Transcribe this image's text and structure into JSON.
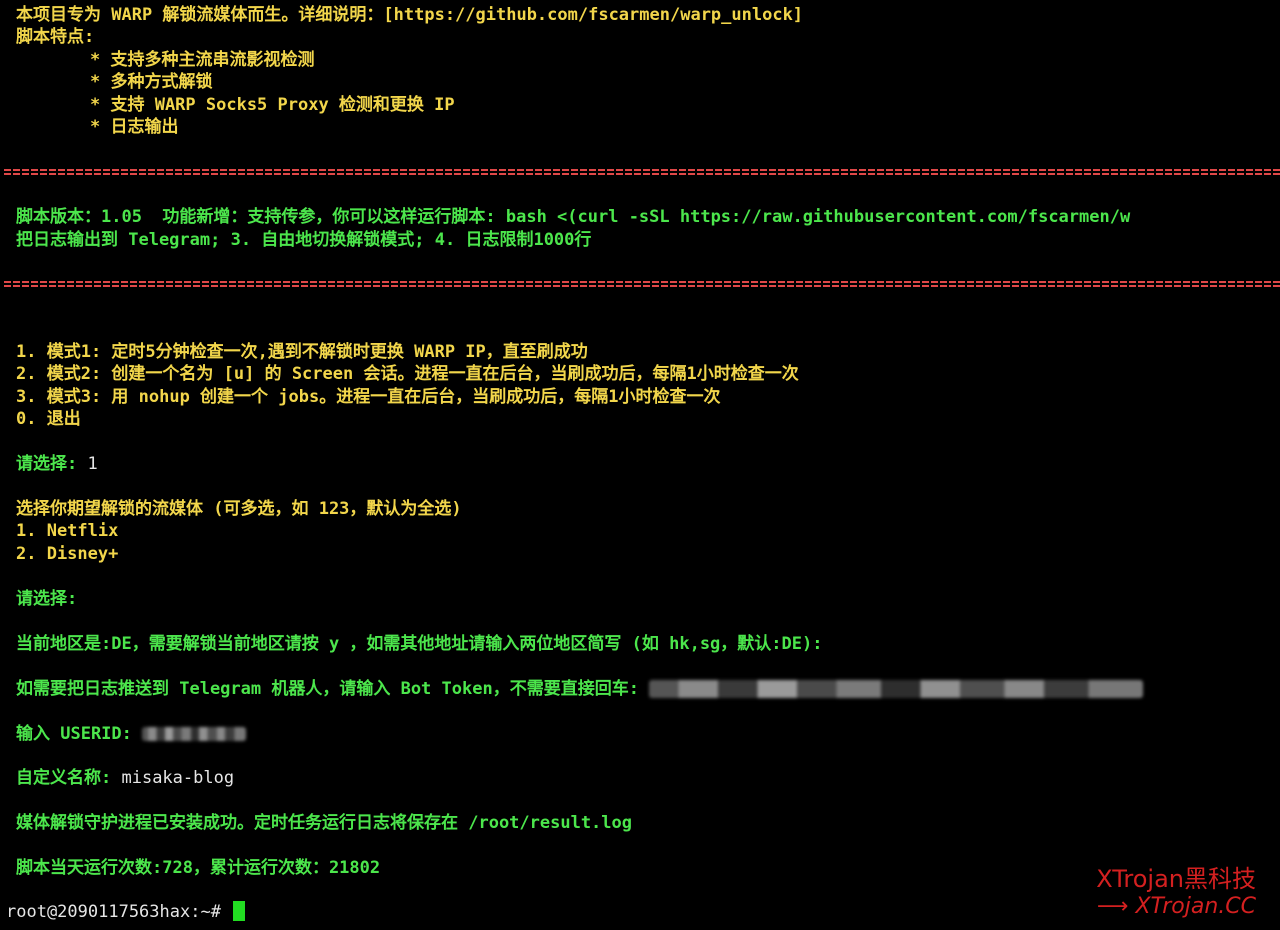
{
  "intro": {
    "line1": "本项目专为 WARP 解锁流媒体而生。详细说明：[https://github.com/fscarmen/warp_unlock]",
    "features_title": "脚本特点:",
    "features": [
      "* 支持多种主流串流影视检测",
      "* 多种方式解锁",
      "* 支持 WARP Socks5 Proxy 检测和更换 IP",
      "* 日志输出"
    ]
  },
  "version": {
    "line1": "脚本版本：1.05  功能新增：支持传参，你可以这样运行脚本: bash <(curl -sSL https://raw.githubusercontent.com/fscarmen/w",
    "line2": "把日志输出到 Telegram; 3. 自由地切换解锁模式; 4. 日志限制1000行"
  },
  "modes": [
    "1. 模式1: 定时5分钟检查一次,遇到不解锁时更换 WARP IP，直至刷成功",
    "2. 模式2: 创建一个名为 [u] 的 Screen 会话。进程一直在后台，当刷成功后，每隔1小时检查一次",
    "3. 模式3: 用 nohup 创建一个 jobs。进程一直在后台，当刷成功后，每隔1小时检查一次",
    "0. 退出"
  ],
  "choice1": {
    "label": "请选择: ",
    "value": "1"
  },
  "media": {
    "title": "选择你期望解锁的流媒体 (可多选，如 123，默认为全选)",
    "options": [
      "1. Netflix",
      "2. Disney+"
    ]
  },
  "choice2": {
    "label": "请选择: "
  },
  "region": "当前地区是:DE，需要解锁当前地区请按 y ，如需其他地址请输入两位地区简写 (如 hk,sg，默认:DE):",
  "telegram": "如需要把日志推送到 Telegram 机器人，请输入 Bot Token，不需要直接回车: ",
  "userid": "输入 USERID: ",
  "custom_name": {
    "label": "自定义名称: ",
    "value": "misaka-blog"
  },
  "success": "媒体解锁守护进程已安装成功。定时任务运行日志将保存在 /root/result.log",
  "stats": "脚本当天运行次数:728，累计运行次数：21802",
  "prompt": "root@2090117563hax:~# ",
  "watermark": {
    "title": "XTrojan黑科技",
    "arrow": "⟶",
    "sub": "XTrojan.CC"
  },
  "colors": {
    "yellow": "#f2d64b",
    "green": "#4ce64c",
    "red": "#e04848",
    "cursor": "#22dd22",
    "watermark": "#d42020"
  }
}
